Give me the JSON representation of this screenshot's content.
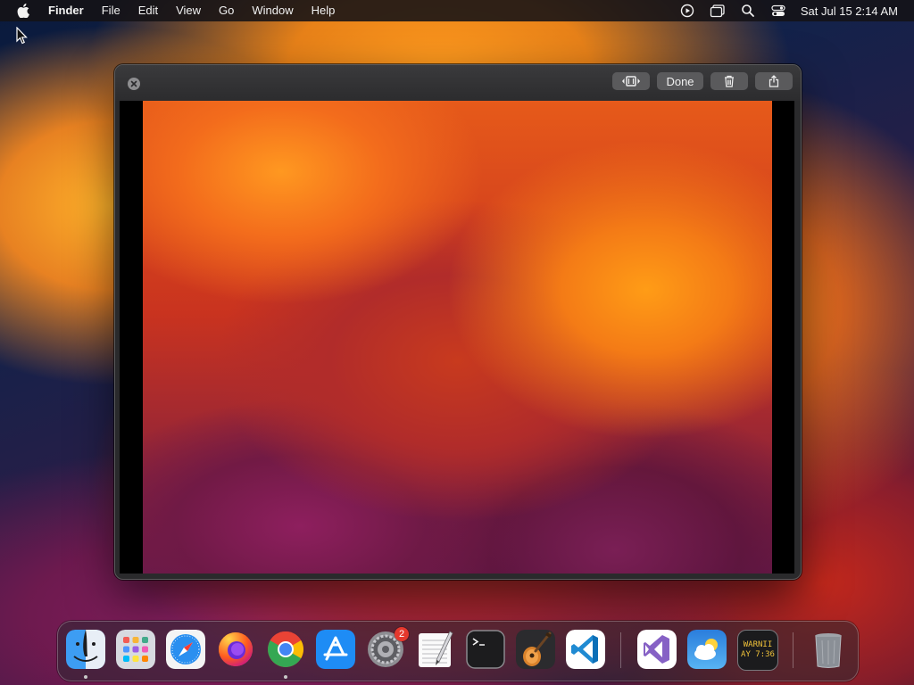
{
  "menubar": {
    "app_name": "Finder",
    "menus": [
      "File",
      "Edit",
      "View",
      "Go",
      "Window",
      "Help"
    ],
    "clock": "Sat Jul 15  2:14 AM",
    "status_icons": [
      "screen-recording-icon",
      "window-stack-icon",
      "spotlight-search-icon",
      "control-center-icon"
    ]
  },
  "quicklook": {
    "done_label": "Done",
    "toolbar_icons": [
      "trim-icon",
      "trash-icon",
      "share-icon"
    ]
  },
  "dock": {
    "apps": [
      {
        "name": "Finder",
        "icon": "finder-icon",
        "running": true
      },
      {
        "name": "Launchpad",
        "icon": "launchpad-icon",
        "running": false
      },
      {
        "name": "Safari",
        "icon": "safari-icon",
        "running": false
      },
      {
        "name": "Firefox",
        "icon": "firefox-icon",
        "running": false
      },
      {
        "name": "Google Chrome",
        "icon": "chrome-icon",
        "running": true
      },
      {
        "name": "App Store",
        "icon": "app-store-icon",
        "running": false
      },
      {
        "name": "System Settings",
        "icon": "system-settings-icon",
        "running": false,
        "badge": "2"
      },
      {
        "name": "TextEdit",
        "icon": "textedit-icon",
        "running": false
      },
      {
        "name": "Terminal",
        "icon": "terminal-icon",
        "running": false
      },
      {
        "name": "GarageBand",
        "icon": "garageband-icon",
        "running": false
      },
      {
        "name": "Visual Studio Code",
        "icon": "vscode-icon",
        "running": false
      },
      {
        "name": "Visual Studio",
        "icon": "visual-studio-icon",
        "running": false
      },
      {
        "name": "Weather",
        "icon": "weather-icon",
        "running": false
      },
      {
        "name": "Console",
        "icon": "console-icon",
        "running": false
      },
      {
        "name": "Trash",
        "icon": "trash-icon",
        "running": false
      }
    ],
    "console_text_line1": "WARNII",
    "console_text_line2": "AY 7:36",
    "settings_badge": "2"
  }
}
